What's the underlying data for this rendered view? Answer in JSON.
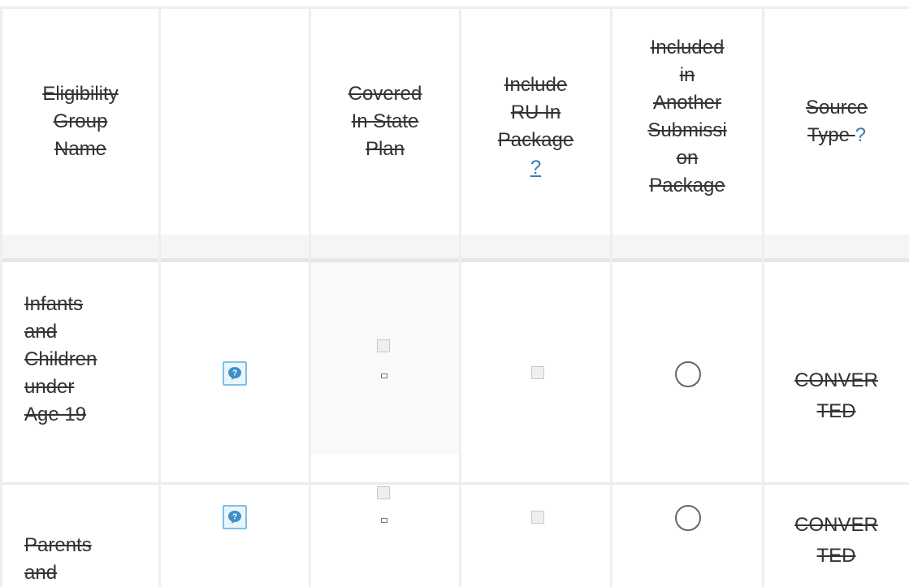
{
  "table": {
    "headers": {
      "group_name": [
        "Eligibility",
        "Group",
        "Name"
      ],
      "icon_col": "",
      "covered": [
        "Covered",
        "In State",
        "Plan"
      ],
      "include_ru": [
        "Include",
        "RU In",
        "Package"
      ],
      "include_ru_help": "?",
      "included_other": [
        "Included",
        "in",
        "Another",
        "Submissi",
        "on",
        "Package"
      ],
      "source_type": [
        "Source",
        "Type"
      ],
      "source_type_help": "?"
    },
    "rows": [
      {
        "name": [
          "Infants",
          "and",
          "Children",
          "under",
          "Age 19"
        ],
        "source_type": [
          "CONVER",
          "TED"
        ]
      },
      {
        "name": [
          "Parents",
          "and"
        ],
        "source_type": [
          "CONVER",
          "TED"
        ]
      }
    ]
  },
  "icons": {
    "help": "help-speech-bubble-icon",
    "radio": "radio-button",
    "checkbox": "checkbox"
  },
  "colors": {
    "help_link": "#3a78b6",
    "help_icon_border": "#7fc0e6",
    "grid": "#eeeeee"
  }
}
